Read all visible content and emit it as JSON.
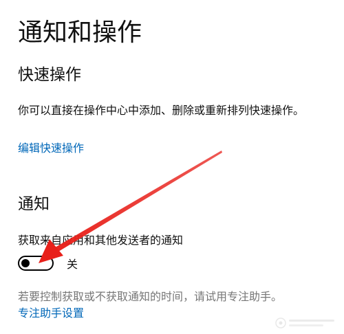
{
  "page": {
    "title": "通知和操作"
  },
  "quick_actions": {
    "heading": "快速操作",
    "description": "你可以直接在操作中心中添加、删除或重新排列快速操作。",
    "edit_link": "编辑快速操作"
  },
  "notifications": {
    "heading": "通知",
    "toggle_label": "获取来自应用和其他发送者的通知",
    "toggle_state": "关",
    "toggle_on": false,
    "hint": "若要控制获取或不获取通知的时间，请试用专注助手。",
    "focus_link": "专注助手设置"
  },
  "annotation": {
    "arrow_color": "#e8201a",
    "arrow_target": "notifications-toggle"
  },
  "colors": {
    "link": "#0067b8",
    "hint": "#767676",
    "text": "#111111"
  }
}
